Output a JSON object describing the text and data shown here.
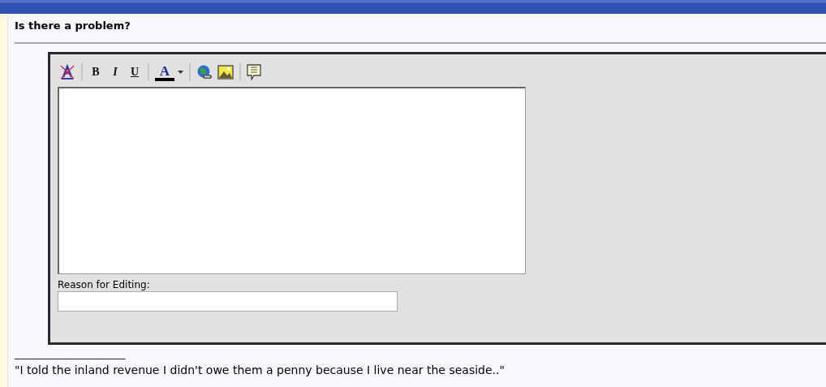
{
  "section_title": "Is there a problem?",
  "toolbar": [
    {
      "kind": "remove-format"
    },
    {
      "kind": "sep"
    },
    {
      "kind": "bold",
      "label": "B"
    },
    {
      "kind": "italic",
      "label": "I"
    },
    {
      "kind": "underline",
      "label": "U"
    },
    {
      "kind": "sep"
    },
    {
      "kind": "color",
      "label": "A",
      "color": "#000000"
    },
    {
      "kind": "sep"
    },
    {
      "kind": "link"
    },
    {
      "kind": "image"
    },
    {
      "kind": "sep"
    },
    {
      "kind": "quote"
    }
  ],
  "reason_label": "Reason for Editing:",
  "signature_rule": "_____________________",
  "signature": "\"I told the inland revenue I didn't owe them a penny because I live near the seaside..\""
}
